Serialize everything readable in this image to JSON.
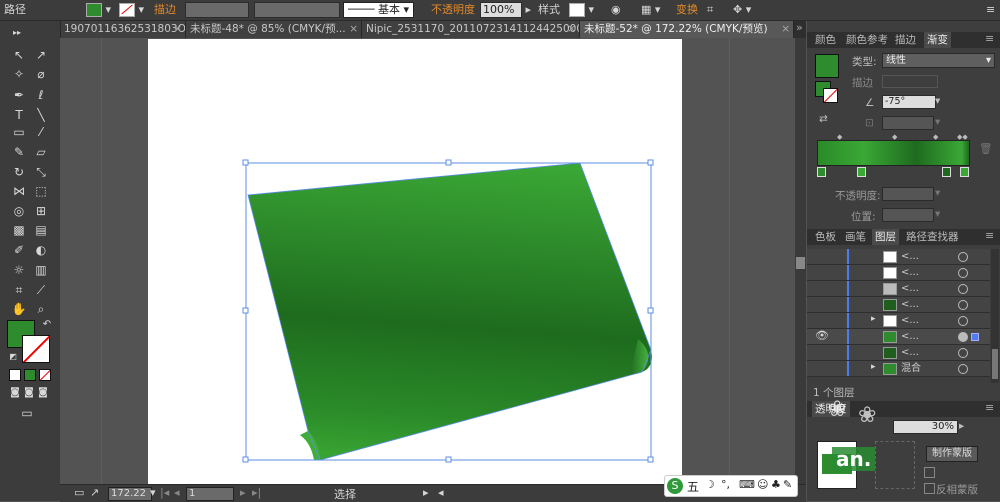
{
  "control_bar": {
    "mode_label": "路径",
    "stroke_label": "描边",
    "stroke_style": "基本",
    "opacity_label": "不透明度",
    "opacity_value": "100%",
    "style_label": "样式",
    "transform_link": "变换",
    "fill_color": "#2e8b2e"
  },
  "document_tabs": [
    {
      "label": "19070116362531803O.ai*"
    },
    {
      "label": "未标题-48* @ 85% (CMYK/预..."
    },
    {
      "label": "Nipic_2531170_20110723141124425000.ai*"
    },
    {
      "label": "未标题-52* @ 172.22% (CMYK/预览)"
    }
  ],
  "status_bar": {
    "zoom": "172.22",
    "page": "1",
    "tool_status": "选择"
  },
  "gradient_panel": {
    "tabs": [
      "颜色",
      "颜色参考",
      "描边",
      "渐变"
    ],
    "type_label": "类型:",
    "type_value": "线性",
    "stroke_label": "描边",
    "angle_value": "-75°",
    "opacity_label": "不透明度:",
    "position_label": "位置:",
    "ramp_dark": "#1f6a1f",
    "ramp_light": "#3faa3a"
  },
  "layers_panel": {
    "tabs": [
      "色板",
      "画笔",
      "图层",
      "路径查找器"
    ],
    "rows": [
      {
        "name": "<..."
      },
      {
        "name": "<..."
      },
      {
        "name": "<..."
      },
      {
        "name": "<..."
      },
      {
        "name": "<..."
      },
      {
        "name": "<..."
      },
      {
        "name": "<..."
      },
      {
        "name": "混合"
      }
    ],
    "count_text": "1 个图层"
  },
  "transparency_panel": {
    "tab_label": "透明度",
    "opacity_value": "30%",
    "make_mask_button": "制作蒙版",
    "invert_mask_label": "反相蒙版"
  },
  "ime_toolbar": {
    "label": "五"
  },
  "watermark": {
    "text": "an."
  },
  "shape_colors": {
    "top": "#39a234",
    "mid": "#1f6a1f",
    "bottom": "#35a030"
  }
}
